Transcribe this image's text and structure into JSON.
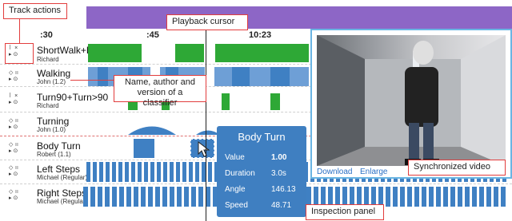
{
  "timeline": {
    "ticks": [
      ":30",
      ":45",
      "10:23"
    ]
  },
  "tracks": [
    {
      "name": "ShortWalk+LongWalk",
      "author": "Richard"
    },
    {
      "name": "Walking",
      "author": "John (1.2)"
    },
    {
      "name": "Turn90+Turn>90",
      "author": "Richard"
    },
    {
      "name": "Turning",
      "author": "John (1.0)"
    },
    {
      "name": "Body Turn",
      "author": "Robert (1.1)"
    },
    {
      "name": "Left Steps",
      "author": "Michael (Regular)"
    },
    {
      "name": "Right Steps",
      "author": "Michael (Regular)"
    }
  ],
  "controls": {
    "row1a": "⠇ ×",
    "row1b": "▸ ⊙",
    "row2a": "◇ ⠶",
    "row2b": "▸ ⊙"
  },
  "callouts": {
    "track_actions": "Track actions",
    "playback_cursor": "Playback cursor",
    "classifier_info": "Name, author and version of a classifier",
    "synced_video": "Synchronized video",
    "inspection_panel": "Inspection panel"
  },
  "video": {
    "download": "Download",
    "enlarge": "Enlarge"
  },
  "inspection": {
    "title": "Body Turn",
    "rows": [
      {
        "label": "Value",
        "value": "1.00"
      },
      {
        "label": "Duration",
        "value": "3.0s"
      },
      {
        "label": "Angle",
        "value": "146.13"
      },
      {
        "label": "Speed",
        "value": "48.71"
      }
    ]
  },
  "colors": {
    "purple": "#8d66c6",
    "green": "#2ea836",
    "blue": "#3f80c3",
    "callout_red": "#e23d3d",
    "video_border": "#6ab5e3"
  }
}
